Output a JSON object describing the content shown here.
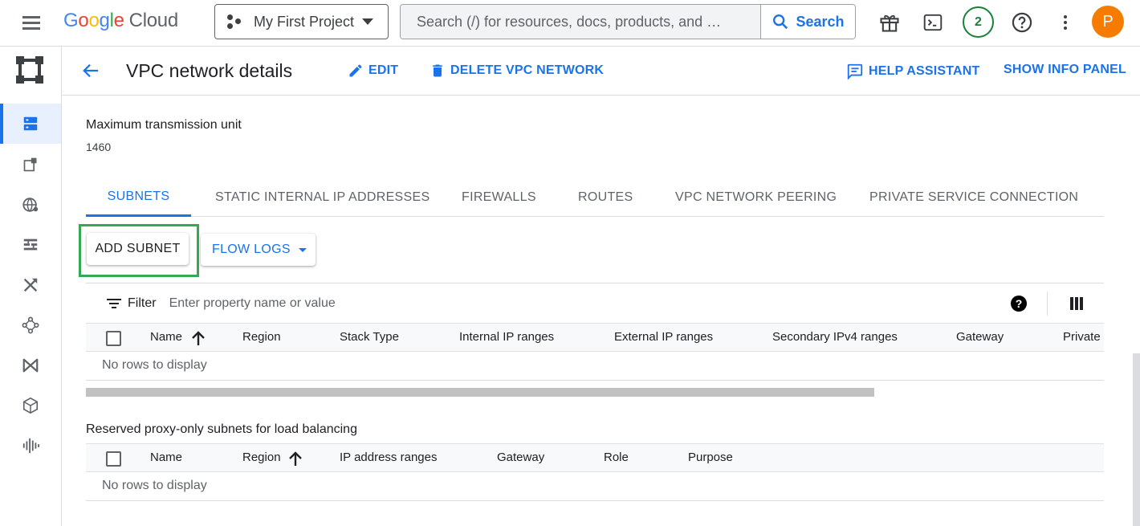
{
  "topbar": {
    "logo_google": [
      "G",
      "o",
      "o",
      "g",
      "l",
      "e"
    ],
    "logo_product": "Cloud",
    "project_name": "My First Project",
    "search_placeholder": "Search (/) for resources, docs, products, and …",
    "search_button": "Search",
    "notification_count": "2",
    "avatar_letter": "P"
  },
  "page": {
    "title": "VPC network details",
    "edit": "EDIT",
    "delete": "DELETE VPC NETWORK",
    "help_assistant": "HELP ASSISTANT",
    "show_info_panel": "SHOW INFO PANEL"
  },
  "mtu": {
    "label": "Maximum transmission unit",
    "value": "1460"
  },
  "tabs": [
    {
      "label": "SUBNETS",
      "active": true
    },
    {
      "label": "STATIC INTERNAL IP ADDRESSES"
    },
    {
      "label": "FIREWALLS"
    },
    {
      "label": "ROUTES"
    },
    {
      "label": "VPC NETWORK PEERING"
    },
    {
      "label": "PRIVATE SERVICE CONNECTION"
    }
  ],
  "actions": {
    "add_subnet": "ADD SUBNET",
    "flow_logs": "FLOW LOGS"
  },
  "filter": {
    "label": "Filter",
    "placeholder": "Enter property name or value"
  },
  "subnets_table": {
    "columns": [
      "Name",
      "Region",
      "Stack Type",
      "Internal IP ranges",
      "External IP ranges",
      "Secondary IPv4 ranges",
      "Gateway",
      "Private"
    ],
    "empty_text": "No rows to display"
  },
  "proxy_section": {
    "title": "Reserved proxy-only subnets for load balancing",
    "columns": [
      "Name",
      "Region",
      "IP address ranges",
      "Gateway",
      "Role",
      "Purpose"
    ],
    "empty_text": "No rows to display"
  },
  "colors": {
    "accent": "#1a73e8",
    "highlight": "#34a853",
    "avatar": "#f57c00"
  },
  "icons": [
    "menu-icon",
    "project-icon",
    "search-icon",
    "gift-icon",
    "cloud-shell-icon",
    "help-icon",
    "more-vert-icon",
    "back-arrow-icon",
    "edit-icon",
    "delete-icon",
    "feedback-icon",
    "filter-icon",
    "column-display-icon",
    "sort-up-icon"
  ]
}
